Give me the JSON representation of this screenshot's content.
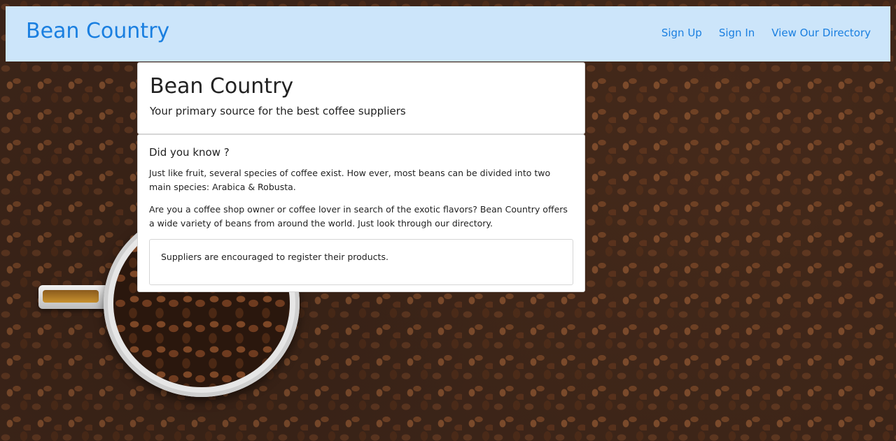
{
  "navbar": {
    "brand": "Bean Country",
    "links": [
      "Sign Up",
      "Sign In",
      "View Our Directory"
    ]
  },
  "hero": {
    "title": "Bean Country",
    "subtitle": "Your primary source for the best coffee suppliers"
  },
  "info": {
    "heading": "Did you know ?",
    "paragraphs": [
      "Just like fruit, several species of coffee exist. How ever, most beans can be divided into two main species: Arabica & Robusta.",
      "Are you a coffee shop owner or coffee lover in search of the exotic flavors? Bean Country offers a wide variety of beans from around the world. Just look through our directory."
    ],
    "notice": "Suppliers are encouraged to register their products."
  },
  "colors": {
    "navbar_bg": "#cce5fa",
    "link": "#1a7fe0"
  }
}
